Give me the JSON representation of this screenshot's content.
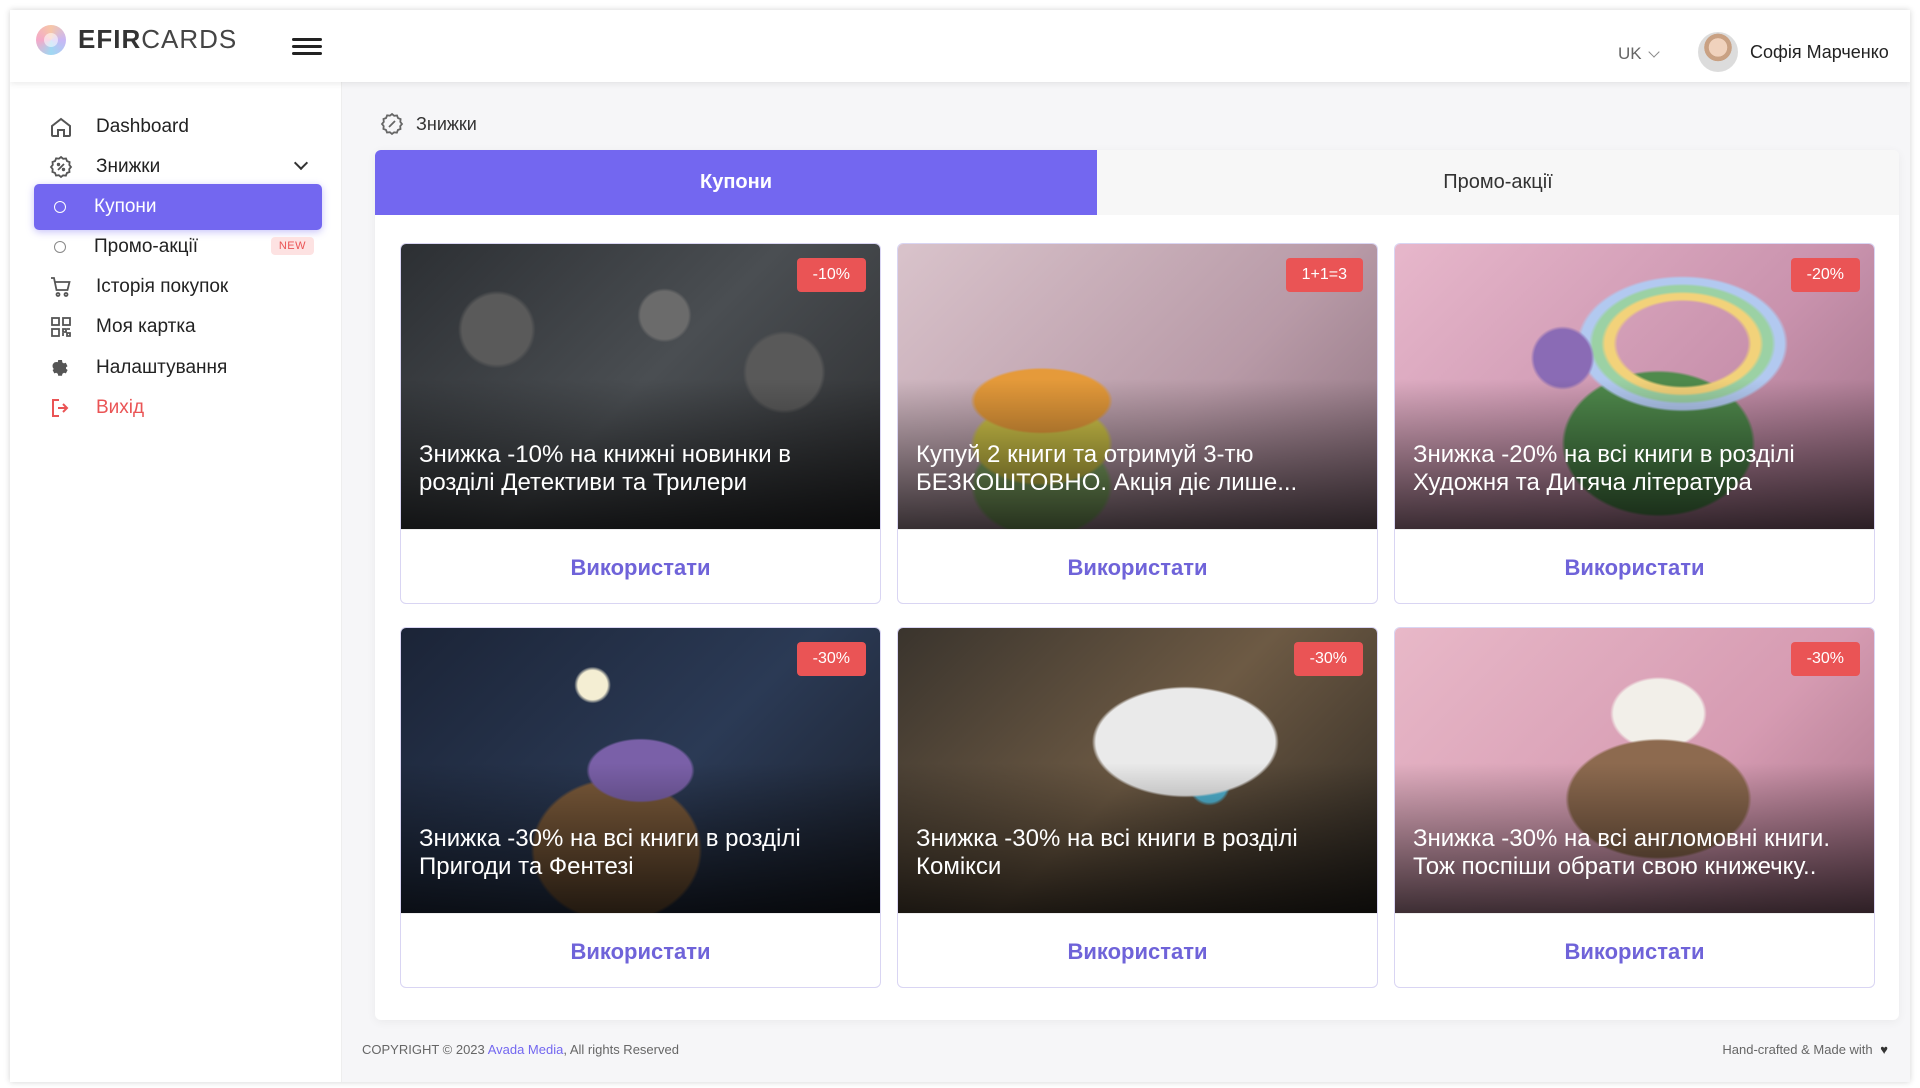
{
  "header": {
    "logo_bold": "EFIR",
    "logo_light": "CARDS",
    "language": "UK",
    "user_name": "Софія Марченко"
  },
  "sidebar": {
    "items": [
      {
        "label": "Dashboard",
        "icon": "home-icon"
      },
      {
        "label": "Знижки",
        "icon": "discount-icon"
      },
      {
        "label": "Купони",
        "icon": "circle-icon"
      },
      {
        "label": "Промо-акції",
        "icon": "circle-icon",
        "badge": "NEW"
      },
      {
        "label": "Історія покупок",
        "icon": "cart-icon"
      },
      {
        "label": "Моя картка",
        "icon": "qr-code-icon"
      },
      {
        "label": "Налаштування",
        "icon": "gear-icon"
      },
      {
        "label": "Вихід",
        "icon": "logout-icon"
      }
    ]
  },
  "breadcrumb": {
    "label": "Знижки"
  },
  "tabs": [
    {
      "label": "Купони",
      "active": true
    },
    {
      "label": "Промо-акції",
      "active": false
    }
  ],
  "cards": [
    {
      "badge": "-10%",
      "title": "Знижка -10% на книжні новинки в розділі Детективи та Трилери",
      "button": "Використати"
    },
    {
      "badge": "1+1=3",
      "title": "Купуй 2 книги та отримуй 3-тю БЕЗКОШТОВНО. Акція діє лише...",
      "button": "Використати"
    },
    {
      "badge": "-20%",
      "title": "Знижка -20% на всі книги в розділі Художня та Дитяча література",
      "button": "Використати"
    },
    {
      "badge": "-30%",
      "title": "Знижка -30% на всі книги в розділі Пригоди та Фентезі",
      "button": "Використати"
    },
    {
      "badge": "-30%",
      "title": "Знижка -30% на всі книги в розділі Комікси",
      "button": "Використати"
    },
    {
      "badge": "-30%",
      "title": "Знижка -30% на всі англомовні книги. Тож поспіши обрати свою книжечку..",
      "button": "Використати"
    }
  ],
  "footer": {
    "copyright_prefix": "COPYRIGHT © 2023",
    "company": "Avada Media",
    "copyright_suffix": ", All rights Reserved",
    "right_text": "Hand-crafted & Made with"
  },
  "colors": {
    "accent": "#7367f0",
    "danger": "#ea5455"
  }
}
